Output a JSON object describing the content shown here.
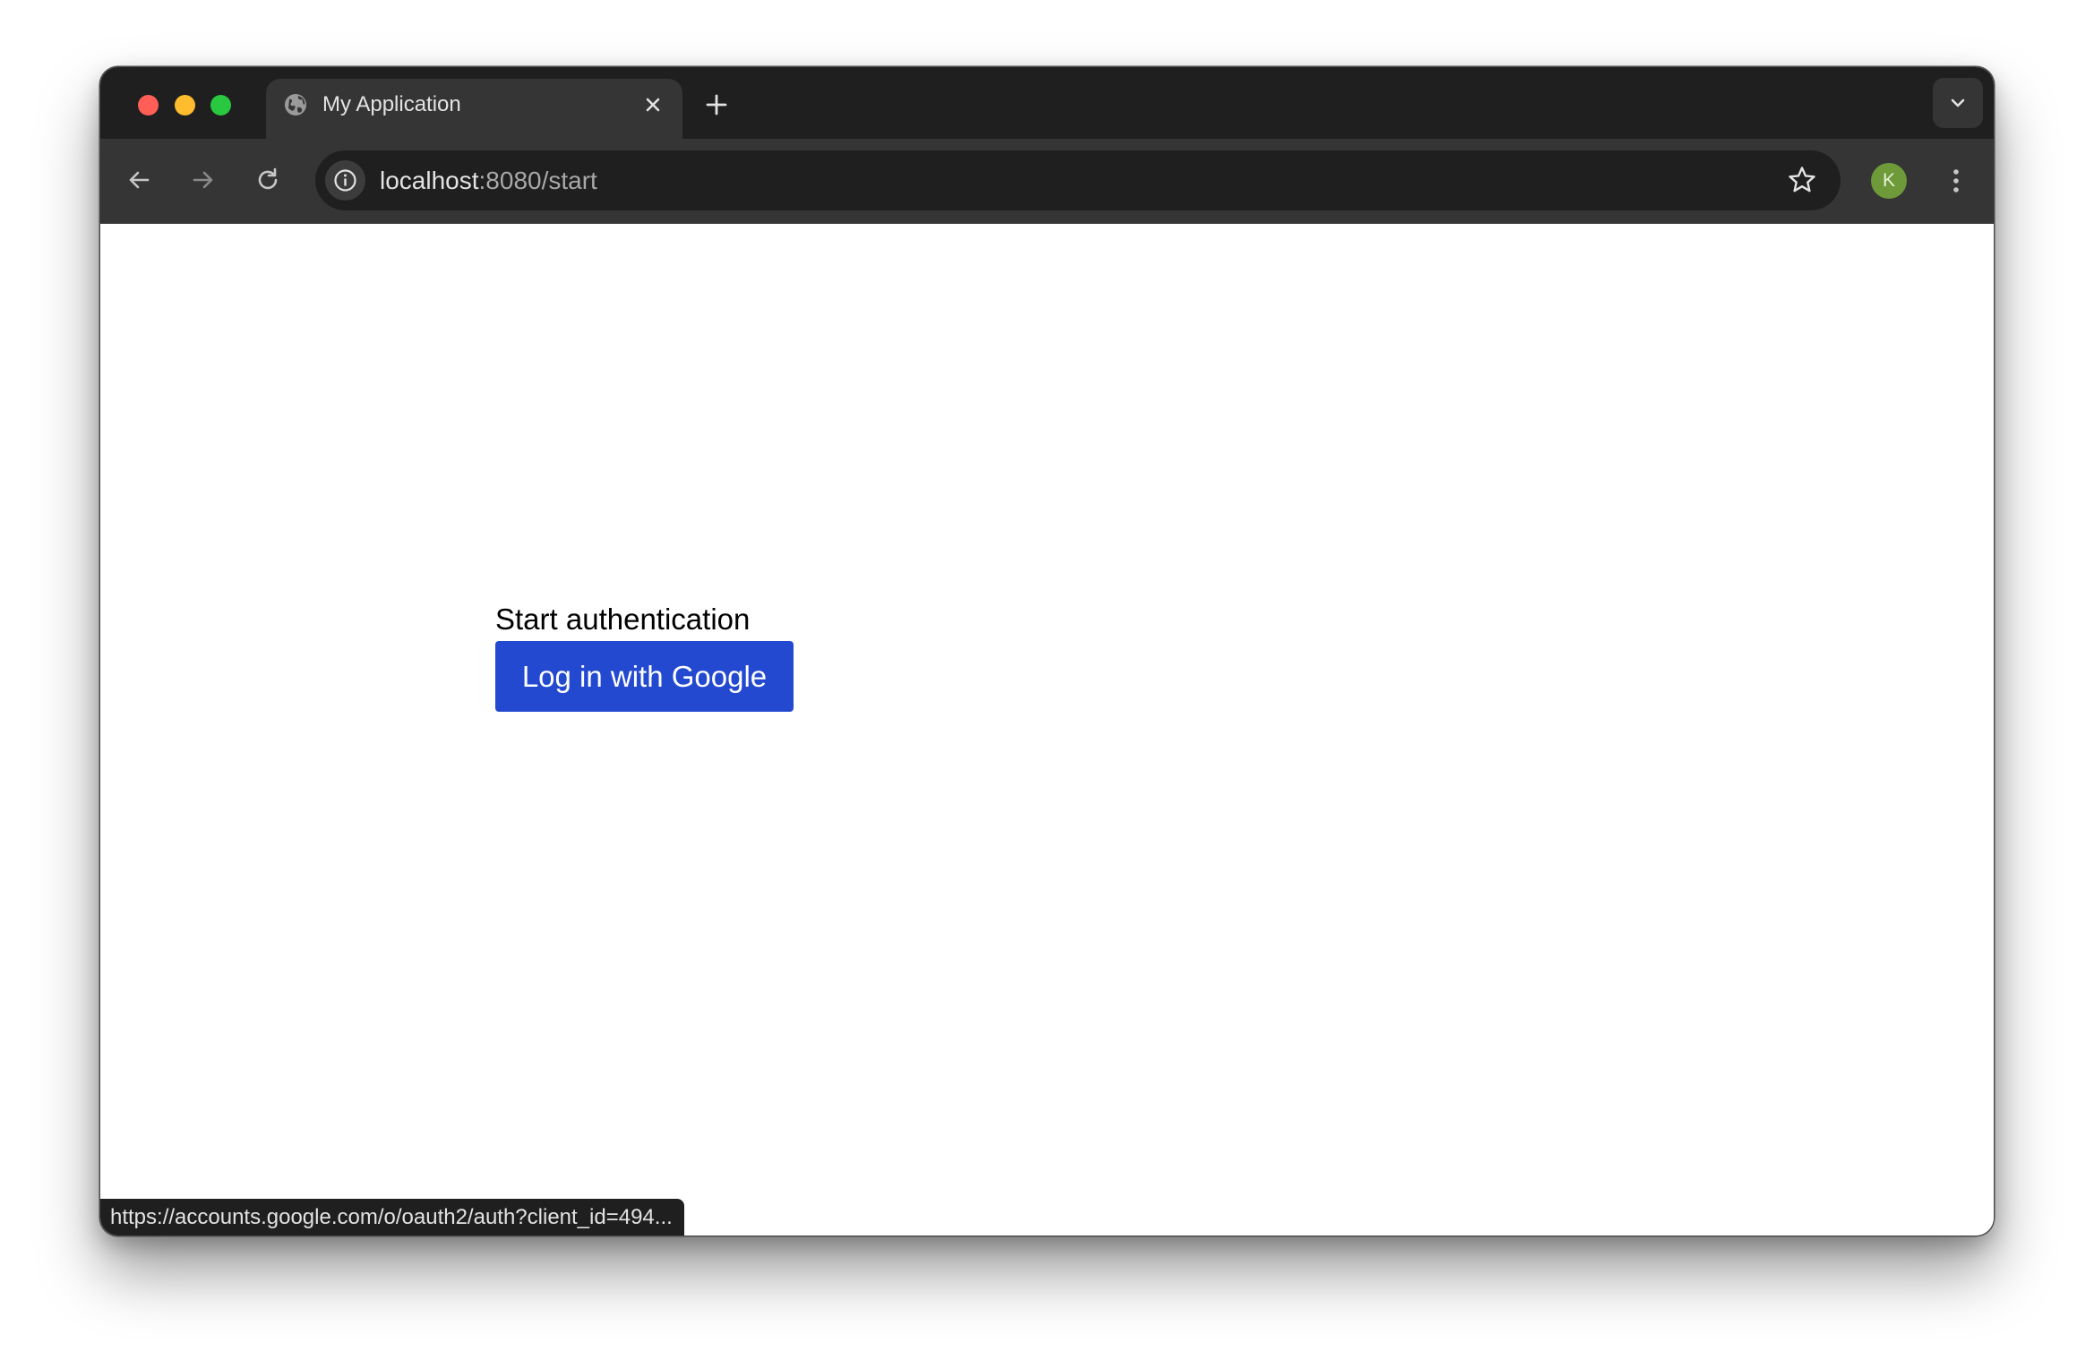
{
  "browser": {
    "tab": {
      "title": "My Application",
      "favicon": "globe-icon",
      "close_icon": "close-icon"
    },
    "new_tab_icon": "plus-icon",
    "tab_search_icon": "chevron-down-icon",
    "toolbar": {
      "back_icon": "arrow-left-icon",
      "forward_icon": "arrow-right-icon",
      "reload_icon": "reload-icon",
      "site_info_icon": "info-icon",
      "url_host": "localhost",
      "url_path": ":8080/start",
      "bookmark_icon": "star-icon",
      "profile_initial": "K",
      "menu_icon": "kebab-menu-icon"
    },
    "status_url": "https://accounts.google.com/o/oauth2/auth?client_id=494..."
  },
  "page": {
    "heading": "Start authentication",
    "login_button_label": "Log in with Google"
  },
  "colors": {
    "button": "#2249d0",
    "avatar": "#6e9a3a",
    "tabstrip": "#1f1f1f",
    "toolbar": "#353535"
  }
}
